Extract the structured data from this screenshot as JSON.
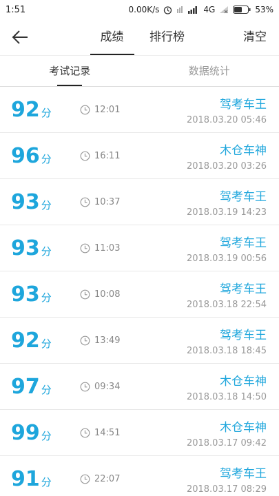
{
  "status_bar": {
    "time": "1:51",
    "network_speed": "0.00K/s",
    "network_type": "4G",
    "battery": "53%",
    "icons": [
      "alarm-icon",
      "signal-icon",
      "battery-icon"
    ]
  },
  "nav": {
    "tabs": [
      {
        "label": "成绩",
        "active": true
      },
      {
        "label": "排行榜",
        "active": false
      }
    ],
    "clear_label": "清空"
  },
  "subtabs": [
    {
      "label": "考试记录",
      "active": true
    },
    {
      "label": "数据统计",
      "active": false
    }
  ],
  "colors": {
    "accent": "#1ea6dc"
  },
  "records": [
    {
      "score": "92",
      "unit": "分",
      "duration": "12:01",
      "name": "驾考车王",
      "datetime": "2018.03.20  05:46"
    },
    {
      "score": "96",
      "unit": "分",
      "duration": "16:11",
      "name": "木仓车神",
      "datetime": "2018.03.20  03:26"
    },
    {
      "score": "93",
      "unit": "分",
      "duration": "10:37",
      "name": "驾考车王",
      "datetime": "2018.03.19  14:23"
    },
    {
      "score": "93",
      "unit": "分",
      "duration": "11:03",
      "name": "驾考车王",
      "datetime": "2018.03.19  00:56"
    },
    {
      "score": "93",
      "unit": "分",
      "duration": "10:08",
      "name": "驾考车王",
      "datetime": "2018.03.18  22:54"
    },
    {
      "score": "92",
      "unit": "分",
      "duration": "13:49",
      "name": "驾考车王",
      "datetime": "2018.03.18  18:45"
    },
    {
      "score": "97",
      "unit": "分",
      "duration": "09:34",
      "name": "木仓车神",
      "datetime": "2018.03.18  14:50"
    },
    {
      "score": "99",
      "unit": "分",
      "duration": "14:51",
      "name": "木仓车神",
      "datetime": "2018.03.17  09:42"
    },
    {
      "score": "91",
      "unit": "分",
      "duration": "22:07",
      "name": "驾考车王",
      "datetime": "2018.03.17  08:29"
    }
  ]
}
